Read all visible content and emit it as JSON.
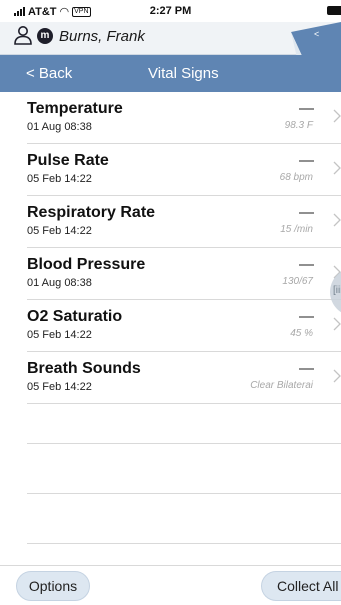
{
  "status_bar": {
    "carrier": "AT&T",
    "wifi_icon": "wifi-icon",
    "vpn_badge": "VPN",
    "time": "2:27 PM",
    "battery_icon": "battery-icon"
  },
  "patient": {
    "person_icon": "person-icon",
    "badge": "m",
    "name": "Burns, Frank"
  },
  "nav": {
    "back_label": "< Back",
    "title": "Vital Signs"
  },
  "vitals": [
    {
      "name": "Temperature",
      "date": "01 Aug 08:38",
      "dash": "—",
      "value": "98.3 F"
    },
    {
      "name": "Pulse Rate",
      "date": "05 Feb 14:22",
      "dash": "—",
      "value": "68 bpm"
    },
    {
      "name": "Respiratory Rate",
      "date": "05 Feb 14:22",
      "dash": "—",
      "value": "15 /min"
    },
    {
      "name": "Blood Pressure",
      "date": "01 Aug 08:38",
      "dash": "—",
      "value": "130/67"
    },
    {
      "name": "O2 Saturatio",
      "date": "05 Feb 14:22",
      "dash": "—",
      "value": "45 %"
    },
    {
      "name": "Breath Sounds",
      "date": "05 Feb 14:22",
      "dash": "—",
      "value": "Clear Bilaterai"
    }
  ],
  "side_handle_label": "[iii",
  "footer": {
    "options_label": "Options",
    "collect_all_label": "Collect All"
  },
  "colors": {
    "nav_bar": "#5f85b3",
    "patient_bar": "#f0f3f6",
    "button_bg": "#dde7f1"
  }
}
